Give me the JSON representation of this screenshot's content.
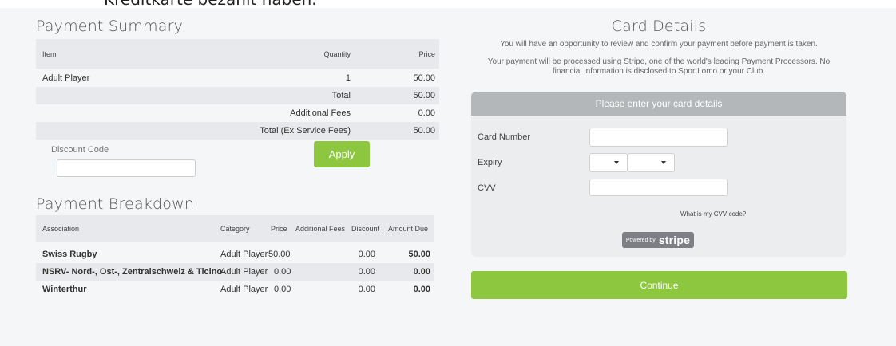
{
  "cut_heading": "Kreditkarte bezahlt haben.",
  "summary": {
    "title": "Payment Summary",
    "headers": {
      "item": "Item",
      "quantity": "Quantity",
      "price": "Price"
    },
    "rows": [
      {
        "item": "Adult Player",
        "quantity": "1",
        "price": "50.00"
      }
    ],
    "totals": [
      {
        "label": "Total",
        "value": "50.00"
      },
      {
        "label": "Additional Fees",
        "value": "0.00"
      },
      {
        "label": "Total (Ex Service Fees)",
        "value": "50.00"
      }
    ],
    "discount_label": "Discount Code",
    "discount_value": "",
    "apply_label": "Apply"
  },
  "breakdown": {
    "title": "Payment Breakdown",
    "headers": {
      "association": "Association",
      "category": "Category",
      "price": "Price",
      "fees": "Additional Fees",
      "discount": "Discount",
      "due": "Amount Due"
    },
    "rows": [
      {
        "association": "Swiss Rugby",
        "category": "Adult Player",
        "price": "50.00",
        "fees": "",
        "discount": "0.00",
        "due": "50.00"
      },
      {
        "association": "NSRV- Nord-, Ost-, Zentralschweiz & Ticino",
        "category": "Adult Player",
        "price": "0.00",
        "fees": "",
        "discount": "0.00",
        "due": "0.00"
      },
      {
        "association": "Winterthur",
        "category": "Adult Player",
        "price": "0.00",
        "fees": "",
        "discount": "0.00",
        "due": "0.00"
      }
    ]
  },
  "card": {
    "title": "Card Details",
    "note1": "You will have an opportunity to review and confirm your payment before payment is taken.",
    "note2": "Your payment will be processed using Stripe, one of the world's leading Payment Processors. No financial information is disclosed to SportLomo or your Club.",
    "panel_header": "Please enter your card details",
    "card_number_label": "Card Number",
    "expiry_label": "Expiry",
    "cvv_label": "CVV",
    "expiry_month": "",
    "expiry_year": "",
    "cvv_help": "What is my CVV code?",
    "powered_by": "Powered by",
    "stripe_word": "stripe",
    "continue_label": "Continue"
  },
  "colors": {
    "accent": "#8dc63f",
    "panel_header": "#b4b7ba",
    "row_shade": "#e7e9ec"
  }
}
